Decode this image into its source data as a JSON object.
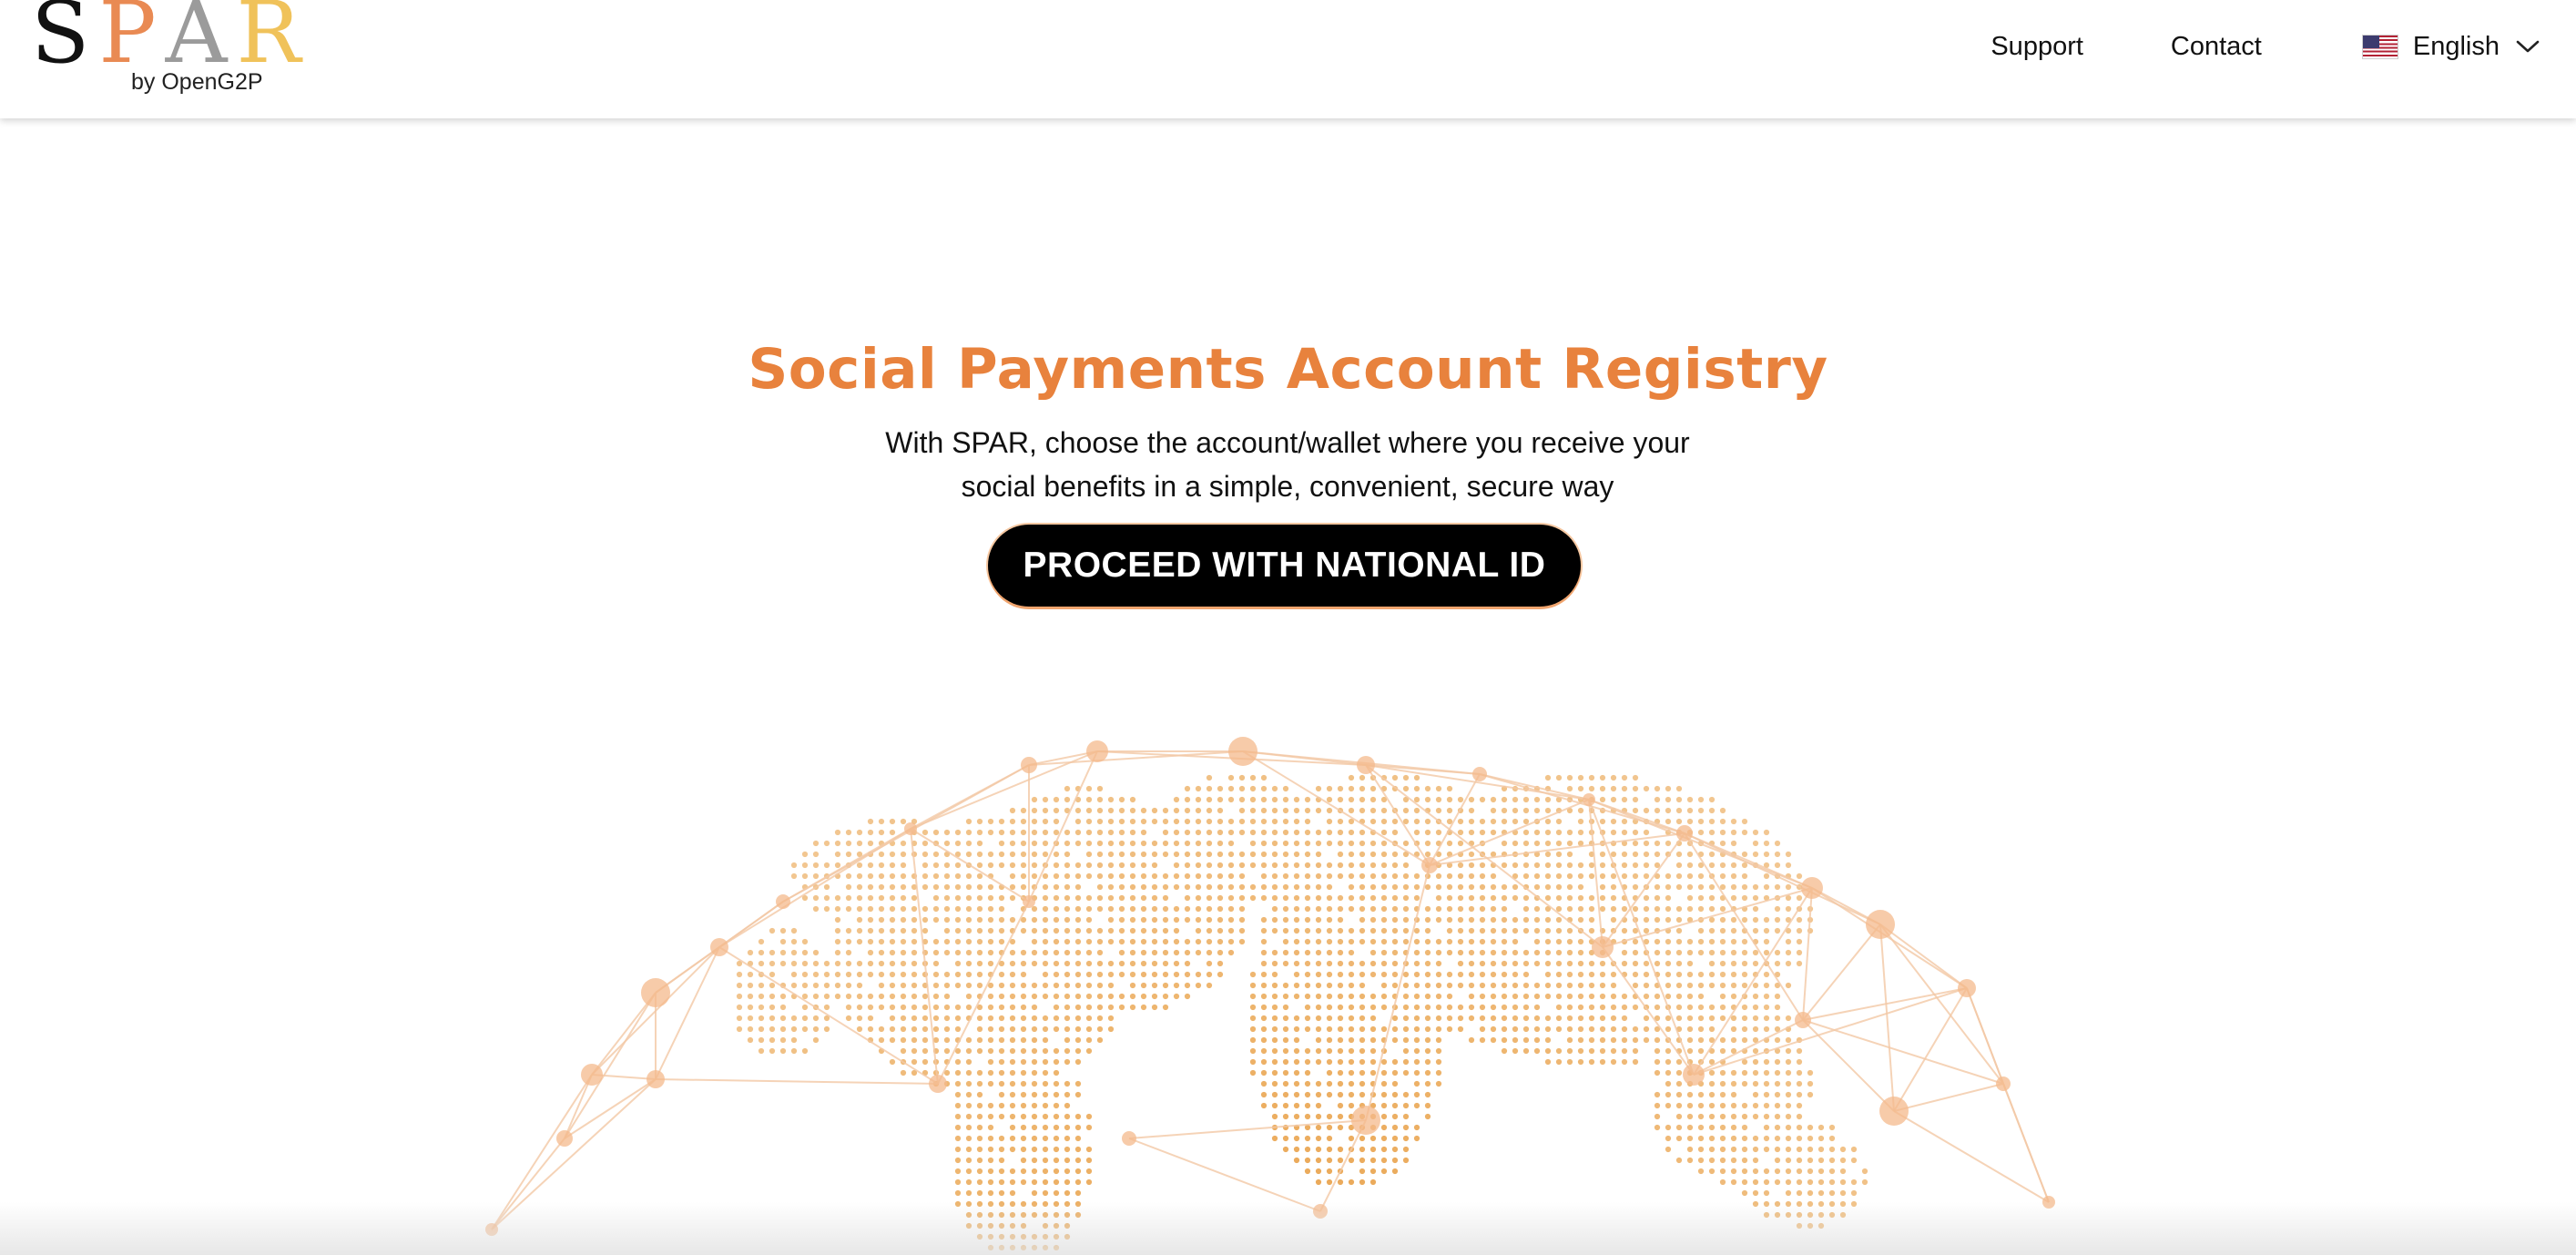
{
  "brand": {
    "letters": [
      "S",
      "P",
      "A",
      "R"
    ],
    "letter_colors": [
      "#111111",
      "#e98a53",
      "#9b9b9b",
      "#f0c25a"
    ],
    "tagline": "by OpenG2P"
  },
  "nav": {
    "support_label": "Support",
    "contact_label": "Contact",
    "language": {
      "label": "English",
      "flag_icon": "us-flag-icon",
      "dropdown_icon": "chevron-down-icon"
    }
  },
  "hero": {
    "title": "Social Payments Account Registry",
    "subtitle": "With SPAR, choose the account/wallet where you receive your social benefits in a simple, convenient, secure way",
    "cta_label": "PROCEED WITH NATIONAL ID"
  },
  "illustration": {
    "name": "world-network-globe",
    "colors": {
      "dots": "#e9a24a",
      "lines": "#f3c9a6",
      "nodes": "#f4b98c"
    }
  }
}
